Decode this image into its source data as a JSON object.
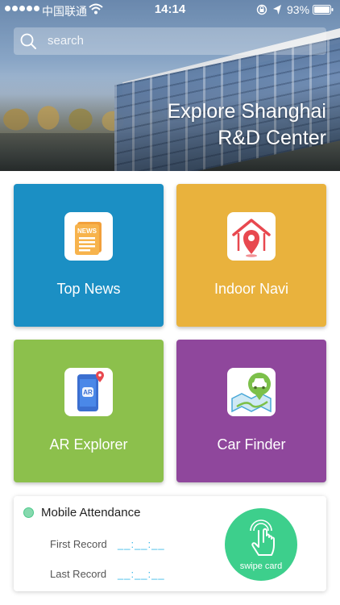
{
  "status_bar": {
    "carrier": "中国联通",
    "time": "14:14",
    "battery": "93%"
  },
  "search": {
    "placeholder": "search"
  },
  "hero": {
    "title_line1": "Explore Shanghai",
    "title_line2": "R&D Center"
  },
  "tiles": [
    {
      "label": "Top News",
      "icon": "news-icon",
      "color": "#1b8fc4",
      "icon_text": "NEWS"
    },
    {
      "label": "Indoor Navi",
      "icon": "house-location-icon",
      "color": "#e9b23d"
    },
    {
      "label": "AR Explorer",
      "icon": "ar-phone-icon",
      "color": "#8cc04c",
      "icon_text": "AR"
    },
    {
      "label": "Car Finder",
      "icon": "car-map-icon",
      "color": "#8f479c"
    }
  ],
  "attendance": {
    "title": "Mobile Attendance",
    "rows": [
      {
        "label": "First Record",
        "value": "__:__:__"
      },
      {
        "label": "Last Record",
        "value": "__:__:__"
      }
    ],
    "swipe_label": "swipe card",
    "accent_color": "#3dcf8c"
  }
}
